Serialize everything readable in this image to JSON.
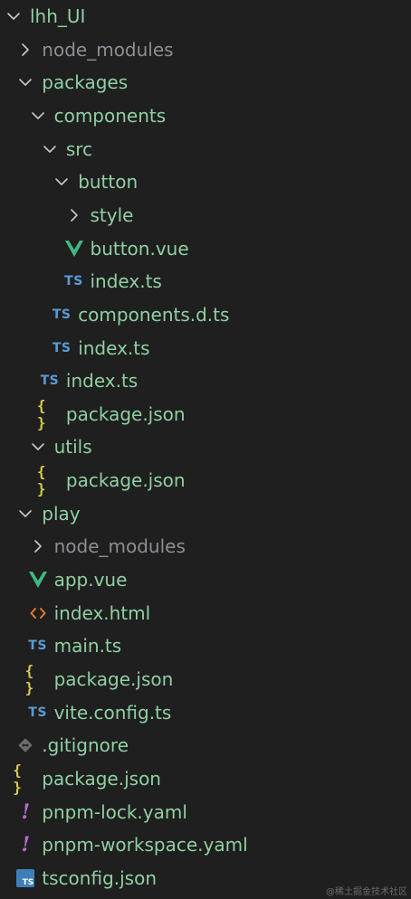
{
  "tree": {
    "items": [
      {
        "label": "lhh_UI",
        "kind": "folder",
        "expanded": true,
        "depth": 0,
        "icon": "chevron-down-icon"
      },
      {
        "label": "node_modules",
        "kind": "folder",
        "expanded": false,
        "depth": 1,
        "icon": "chevron-right-icon"
      },
      {
        "label": "packages",
        "kind": "folder",
        "expanded": true,
        "depth": 1,
        "icon": "chevron-down-icon"
      },
      {
        "label": "components",
        "kind": "folder",
        "expanded": true,
        "depth": 2,
        "icon": "chevron-down-icon"
      },
      {
        "label": "src",
        "kind": "folder",
        "expanded": true,
        "depth": 3,
        "icon": "chevron-down-icon"
      },
      {
        "label": "button",
        "kind": "folder",
        "expanded": true,
        "depth": 4,
        "icon": "chevron-down-icon"
      },
      {
        "label": "style",
        "kind": "folder",
        "expanded": false,
        "depth": 5,
        "icon": "chevron-right-icon"
      },
      {
        "label": "button.vue",
        "kind": "file",
        "depth": 5,
        "icon": "vue-icon"
      },
      {
        "label": "index.ts",
        "kind": "file",
        "depth": 5,
        "icon": "ts-icon",
        "icon_text": "TS"
      },
      {
        "label": "components.d.ts",
        "kind": "file",
        "depth": 4,
        "icon": "ts-icon",
        "icon_text": "TS"
      },
      {
        "label": "index.ts",
        "kind": "file",
        "depth": 4,
        "icon": "ts-icon",
        "icon_text": "TS"
      },
      {
        "label": "index.ts",
        "kind": "file",
        "depth": 3,
        "icon": "ts-icon",
        "icon_text": "TS"
      },
      {
        "label": "package.json",
        "kind": "file",
        "depth": 3,
        "icon": "json-icon",
        "icon_text": "{ }"
      },
      {
        "label": "utils",
        "kind": "folder",
        "expanded": true,
        "depth": 2,
        "icon": "chevron-down-icon"
      },
      {
        "label": "package.json",
        "kind": "file",
        "depth": 3,
        "icon": "json-icon",
        "icon_text": "{ }"
      },
      {
        "label": "play",
        "kind": "folder",
        "expanded": true,
        "depth": 1,
        "icon": "chevron-down-icon"
      },
      {
        "label": "node_modules",
        "kind": "folder",
        "expanded": false,
        "depth": 2,
        "icon": "chevron-right-icon"
      },
      {
        "label": "app.vue",
        "kind": "file",
        "depth": 2,
        "icon": "vue-icon"
      },
      {
        "label": "index.html",
        "kind": "file",
        "depth": 2,
        "icon": "html-icon"
      },
      {
        "label": "main.ts",
        "kind": "file",
        "depth": 2,
        "icon": "ts-icon",
        "icon_text": "TS"
      },
      {
        "label": "package.json",
        "kind": "file",
        "depth": 2,
        "icon": "json-icon",
        "icon_text": "{ }"
      },
      {
        "label": "vite.config.ts",
        "kind": "file",
        "depth": 2,
        "icon": "ts-icon",
        "icon_text": "TS"
      },
      {
        "label": ".gitignore",
        "kind": "file",
        "depth": 1,
        "icon": "git-icon"
      },
      {
        "label": "package.json",
        "kind": "file",
        "depth": 1,
        "icon": "json-icon",
        "icon_text": "{ }"
      },
      {
        "label": "pnpm-lock.yaml",
        "kind": "file",
        "depth": 1,
        "icon": "yaml-icon",
        "icon_text": "!"
      },
      {
        "label": "pnpm-workspace.yaml",
        "kind": "file",
        "depth": 1,
        "icon": "yaml-icon",
        "icon_text": "!"
      },
      {
        "label": "tsconfig.json",
        "kind": "file",
        "depth": 1,
        "icon": "tsconfig-icon",
        "icon_text": "TS"
      }
    ]
  },
  "watermark": "@稀土掘金技术社区",
  "colors": {
    "background": "#1f1f1f",
    "label": "#8fd0a2",
    "muted_label": "#8a8f94",
    "chevron": "#c8c8c8",
    "ts": "#5b9bd5",
    "json": "#d6c94c",
    "yaml": "#b46ecb",
    "vue": "#41b883",
    "html": "#e37933",
    "git": "#6b6b6b"
  }
}
